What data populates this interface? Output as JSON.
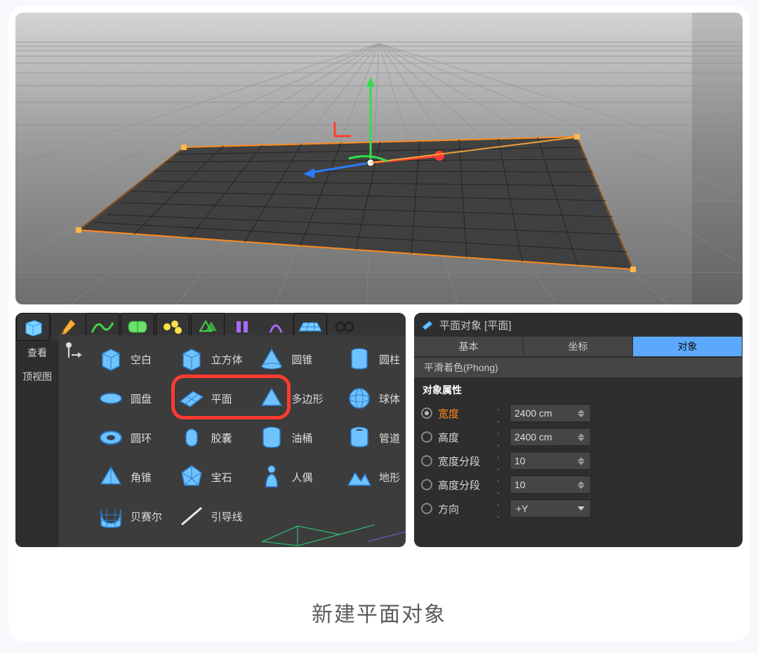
{
  "caption": "新建平面对象",
  "leftCol": {
    "view": "查看",
    "top": "顶视图"
  },
  "top_icons": [
    "cube-icon",
    "pen-icon",
    "spline-arc-icon",
    "subdiv-icon",
    "array-icon",
    "instance-icon",
    "extrude-icon",
    "boole-icon",
    "floor-icon",
    "camera-icon"
  ],
  "primitives": {
    "col1": [
      {
        "name": "null",
        "label": "空白",
        "svg": "cube"
      },
      {
        "name": "disc",
        "label": "圆盘",
        "svg": "disc"
      },
      {
        "name": "torus",
        "label": "圆环",
        "svg": "torus"
      },
      {
        "name": "pyramid",
        "label": "角锥",
        "svg": "pyramid"
      },
      {
        "name": "bezier",
        "label": "贝赛尔",
        "svg": "bezier"
      }
    ],
    "col2": [
      {
        "name": "cube",
        "label": "立方体",
        "svg": "cube"
      },
      {
        "name": "plane",
        "label": "平面",
        "svg": "plane"
      },
      {
        "name": "capsule",
        "label": "胶囊",
        "svg": "capsule"
      },
      {
        "name": "platonic",
        "label": "宝石",
        "svg": "platonic"
      },
      {
        "name": "guide",
        "label": "引导线",
        "svg": "guide"
      }
    ],
    "col3": [
      {
        "name": "cone",
        "label": "圆锥",
        "svg": "cone"
      },
      {
        "name": "polygon",
        "label": "多边形",
        "svg": "polygon"
      },
      {
        "name": "oiltank",
        "label": "油桶",
        "svg": "oiltank"
      },
      {
        "name": "figure",
        "label": "人偶",
        "svg": "figure"
      }
    ],
    "col4": [
      {
        "name": "cylinder",
        "label": "圆柱",
        "svg": "cylinder"
      },
      {
        "name": "sphere",
        "label": "球体",
        "svg": "sphere"
      },
      {
        "name": "tube",
        "label": "管道",
        "svg": "tube"
      },
      {
        "name": "landscape",
        "label": "地形",
        "svg": "landscape"
      }
    ]
  },
  "props": {
    "title": "平面对象 [平面]",
    "tabs": {
      "basic": "基本",
      "coord": "坐标",
      "object": "对象"
    },
    "phong": "平滑着色(Phong)",
    "section": "对象属性",
    "rows": [
      {
        "key": "width",
        "label": "宽度",
        "value": "2400 cm",
        "hot": true,
        "type": "num"
      },
      {
        "key": "height",
        "label": "高度",
        "value": "2400 cm",
        "hot": false,
        "type": "num"
      },
      {
        "key": "wseg",
        "label": "宽度分段",
        "value": "10",
        "hot": false,
        "type": "num"
      },
      {
        "key": "hseg",
        "label": "高度分段",
        "value": "10",
        "hot": false,
        "type": "num"
      },
      {
        "key": "orient",
        "label": "方向",
        "value": "+Y",
        "hot": false,
        "type": "dd"
      }
    ]
  }
}
